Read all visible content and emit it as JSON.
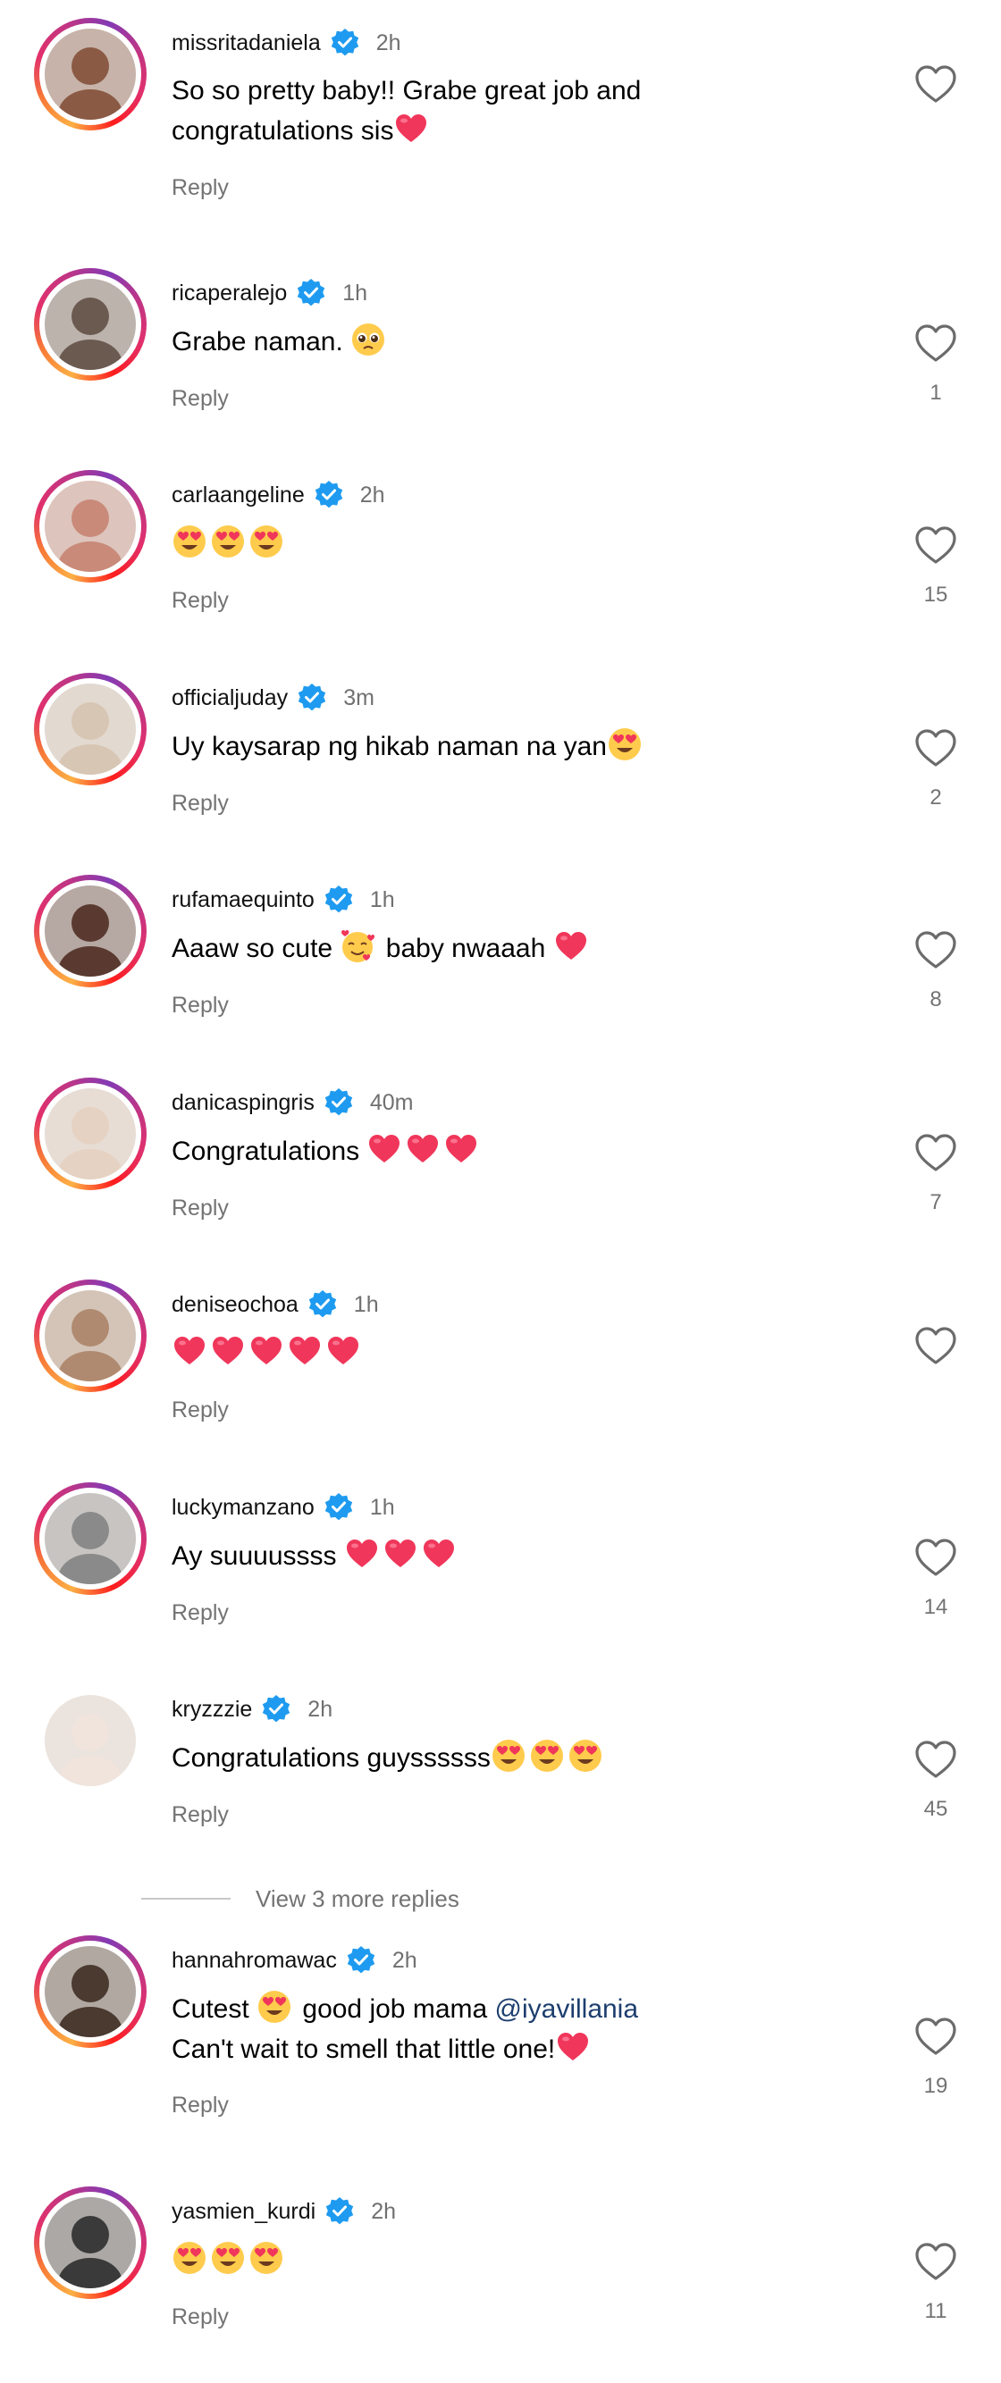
{
  "comments": [
    {
      "username": "missritadaniela",
      "verified": true,
      "time": "2h",
      "lines": [
        [
          {
            "t": "So so pretty baby!! Grabe great job and"
          }
        ],
        [
          {
            "t": "congratulations sis"
          },
          {
            "e": "heart"
          }
        ]
      ],
      "reply": "Reply",
      "likes": "",
      "avatar_color": "#8a5a44",
      "ring": true
    },
    {
      "username": "ricaperalejo",
      "verified": true,
      "time": "1h",
      "lines": [
        [
          {
            "t": "Grabe naman. "
          },
          {
            "e": "pleading"
          }
        ]
      ],
      "reply": "Reply",
      "likes": "1",
      "avatar_color": "#6b5a50",
      "ring": true
    },
    {
      "username": "carlaangeline",
      "verified": true,
      "time": "2h",
      "lines": [
        [
          {
            "e": "heart-eyes"
          },
          {
            "e": "heart-eyes"
          },
          {
            "e": "heart-eyes"
          }
        ]
      ],
      "reply": "Reply",
      "likes": "15",
      "avatar_color": "#c98a7a",
      "ring": true
    },
    {
      "username": "officialjuday",
      "verified": true,
      "time": "3m",
      "lines": [
        [
          {
            "t": "Uy kaysarap ng hikab naman na yan"
          },
          {
            "e": "heart-eyes"
          }
        ]
      ],
      "reply": "Reply",
      "likes": "2",
      "avatar_color": "#d8c6b4",
      "ring": true
    },
    {
      "username": "rufamaequinto",
      "verified": true,
      "time": "1h",
      "lines": [
        [
          {
            "t": "Aaaw so cute "
          },
          {
            "e": "smiling-hearts"
          },
          {
            "t": " baby nwaaah "
          },
          {
            "e": "heart"
          }
        ]
      ],
      "reply": "Reply",
      "likes": "8",
      "avatar_color": "#5a3a30",
      "ring": true
    },
    {
      "username": "danicaspingris",
      "verified": true,
      "time": "40m",
      "lines": [
        [
          {
            "t": "Congratulations "
          },
          {
            "e": "heart"
          },
          {
            "e": "heart"
          },
          {
            "e": "heart"
          }
        ]
      ],
      "reply": "Reply",
      "likes": "7",
      "avatar_color": "#e6d2c2",
      "ring": true
    },
    {
      "username": "deniseochoa",
      "verified": true,
      "time": "1h",
      "lines": [
        [
          {
            "e": "heart"
          },
          {
            "e": "heart"
          },
          {
            "e": "heart"
          },
          {
            "e": "heart"
          },
          {
            "e": "heart"
          }
        ]
      ],
      "reply": "Reply",
      "likes": "",
      "avatar_color": "#b08a70",
      "ring": true
    },
    {
      "username": "luckymanzano",
      "verified": true,
      "time": "1h",
      "lines": [
        [
          {
            "t": "Ay suuuussss "
          },
          {
            "e": "heart"
          },
          {
            "e": "heart"
          },
          {
            "e": "heart"
          }
        ]
      ],
      "reply": "Reply",
      "likes": "14",
      "avatar_color": "#8a8a8a",
      "ring": true
    },
    {
      "username": "kryzzzie",
      "verified": true,
      "time": "2h",
      "lines": [
        [
          {
            "t": "Congratulations guyssssss"
          },
          {
            "e": "heart-eyes"
          },
          {
            "e": "heart-eyes"
          },
          {
            "e": "heart-eyes"
          }
        ]
      ],
      "reply": "Reply",
      "likes": "45",
      "avatar_color": "#f0e4dc",
      "ring": false
    },
    {
      "username": "hannahromawac",
      "verified": true,
      "time": "2h",
      "lines": [
        [
          {
            "t": "Cutest "
          },
          {
            "e": "heart-eyes"
          },
          {
            "t": " good job mama "
          },
          {
            "m": "@iyavillania"
          }
        ],
        [
          {
            "t": "Can't wait to smell that little one!"
          },
          {
            "e": "heart"
          }
        ]
      ],
      "reply": "Reply",
      "likes": "19",
      "avatar_color": "#4a3a30",
      "ring": true
    },
    {
      "username": "yasmien_kurdi",
      "verified": true,
      "time": "2h",
      "lines": [
        [
          {
            "e": "heart-eyes"
          },
          {
            "e": "heart-eyes"
          },
          {
            "e": "heart-eyes"
          }
        ]
      ],
      "reply": "Reply",
      "likes": "11",
      "avatar_color": "#3a3a3a",
      "ring": true
    }
  ],
  "view_more": {
    "label": "View 3 more replies"
  },
  "colors": {
    "verified": "#1e9bf0",
    "text": "#000000",
    "meta": "#737373",
    "heart_emoji": "#f0365a"
  }
}
